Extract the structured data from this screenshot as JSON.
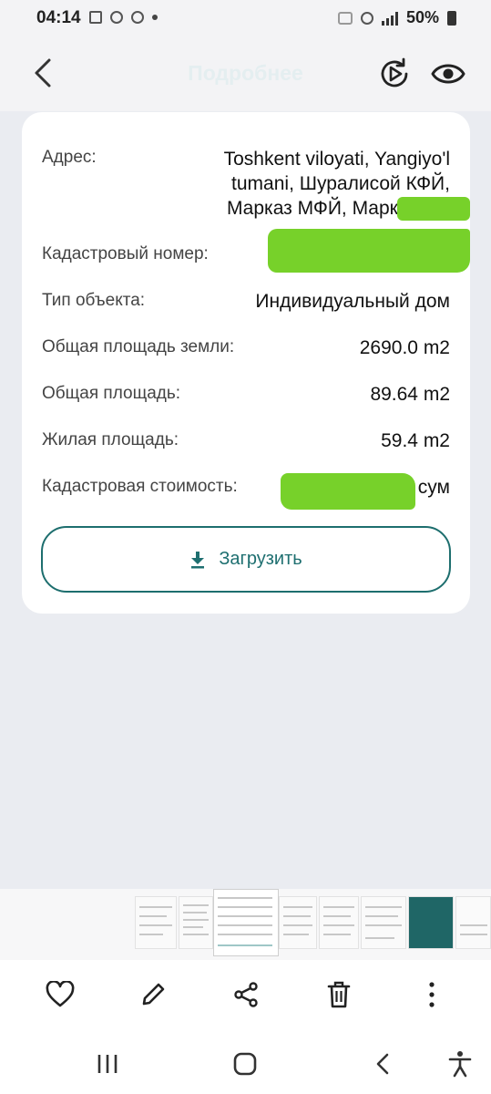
{
  "status_bar": {
    "time": "04:14",
    "battery": "50%"
  },
  "header": {
    "title": "Подробнее",
    "back_icon": "chevron-left-icon",
    "replay_icon": "replay-video-icon",
    "view_icon": "eye-icon"
  },
  "details": {
    "address_label": "Адрес:",
    "address_lines": [
      "Toshkent viloyati, Yangiyo'l",
      "tumani, Шуралисой  КФЙ,",
      "Марказ МФЙ, Марказ, до"
    ],
    "cadastral_label": "Кадастровый номер:",
    "type_label": "Тип объекта:",
    "type_value": "Индивидуальный дом",
    "land_area_label": "Общая площадь земли:",
    "land_area_value": "2690.0 m2",
    "total_area_label": "Общая площадь:",
    "total_area_value": "89.64 m2",
    "living_area_label": "Жилая площадь:",
    "living_area_value": "59.4 m2",
    "cost_label": "Кадастровая стоимость:",
    "cost_currency": "сум"
  },
  "download_button": {
    "label": "Загрузить",
    "icon": "download-icon"
  },
  "actions": [
    "heart-icon",
    "pencil-icon",
    "share-icon",
    "trash-icon",
    "more-vertical-icon"
  ],
  "navigation": [
    "recents-icon",
    "home-icon",
    "back-icon",
    "accessibility-icon"
  ],
  "colors": {
    "accent": "#1d6e6e",
    "background": "#eaecf1",
    "redaction": "#77d12a"
  }
}
